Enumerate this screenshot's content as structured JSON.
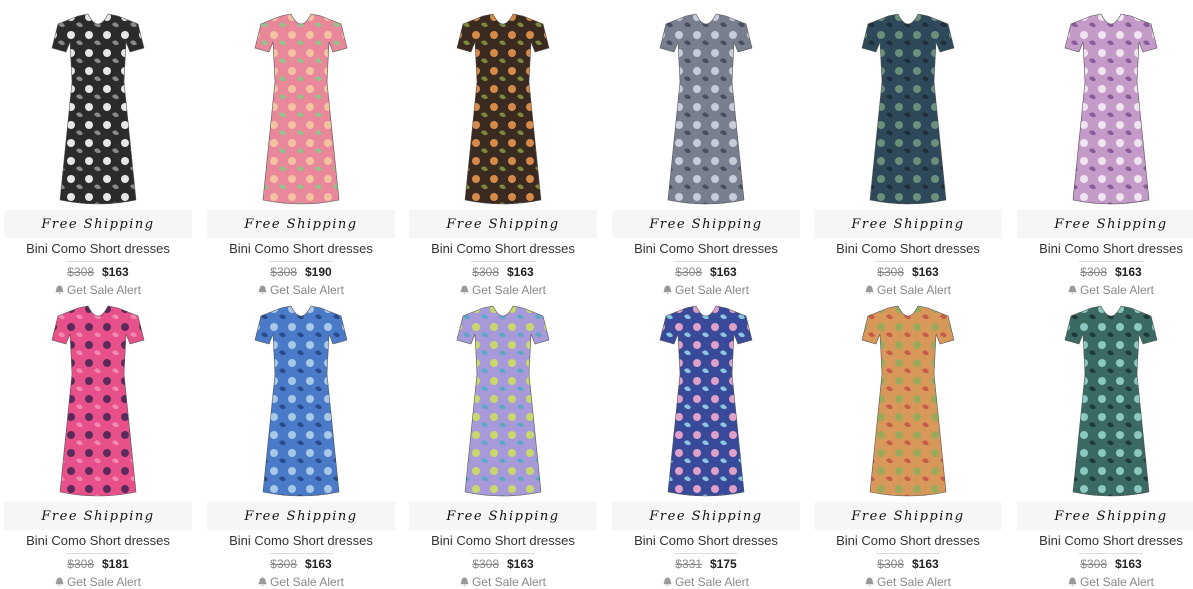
{
  "products": [
    {
      "free_shipping": "Free Shipping",
      "title": "Bini Como Short dresses",
      "old_price": "$308",
      "new_price": "$163",
      "alert": "Get Sale Alert",
      "colors": [
        "#2b2b2b",
        "#e6e6e6",
        "#8a8a8a"
      ]
    },
    {
      "free_shipping": "Free Shipping",
      "title": "Bini Como Short dresses",
      "old_price": "$308",
      "new_price": "$190",
      "alert": "Get Sale Alert",
      "colors": [
        "#e8889a",
        "#f3c3a0",
        "#8fc48a"
      ]
    },
    {
      "free_shipping": "Free Shipping",
      "title": "Bini Como Short dresses",
      "old_price": "$308",
      "new_price": "$163",
      "alert": "Get Sale Alert",
      "colors": [
        "#3a2a20",
        "#d58a4a",
        "#7a8a3a"
      ]
    },
    {
      "free_shipping": "Free Shipping",
      "title": "Bini Como Short dresses",
      "old_price": "$308",
      "new_price": "$163",
      "alert": "Get Sale Alert",
      "colors": [
        "#7a7f8f",
        "#c7ccd8",
        "#4a4f60"
      ]
    },
    {
      "free_shipping": "Free Shipping",
      "title": "Bini Como Short dresses",
      "old_price": "$308",
      "new_price": "$163",
      "alert": "Get Sale Alert",
      "colors": [
        "#2e4a5a",
        "#6a8f7a",
        "#1f2f3a"
      ]
    },
    {
      "free_shipping": "Free Shipping",
      "title": "Bini Como Short dresses",
      "old_price": "$308",
      "new_price": "$163",
      "alert": "Get Sale Alert",
      "colors": [
        "#c49ac8",
        "#f0e4f0",
        "#8a5a9a"
      ]
    },
    {
      "free_shipping": "Free Shipping",
      "title": "Bini Como Short dresses",
      "old_price": "$308",
      "new_price": "$181",
      "alert": "Get Sale Alert",
      "colors": [
        "#e8508a",
        "#5a2a5a",
        "#f08ab0"
      ]
    },
    {
      "free_shipping": "Free Shipping",
      "title": "Bini Como Short dresses",
      "old_price": "$308",
      "new_price": "$163",
      "alert": "Get Sale Alert",
      "colors": [
        "#4a7ac8",
        "#a8c8e8",
        "#2a4a8a"
      ]
    },
    {
      "free_shipping": "Free Shipping",
      "title": "Bini Como Short dresses",
      "old_price": "$308",
      "new_price": "$163",
      "alert": "Get Sale Alert",
      "colors": [
        "#a89ad8",
        "#c8d86a",
        "#5aa8c8"
      ]
    },
    {
      "free_shipping": "Free Shipping",
      "title": "Bini Como Short dresses",
      "old_price": "$331",
      "new_price": "$175",
      "alert": "Get Sale Alert",
      "colors": [
        "#3a4a9a",
        "#e0a0c8",
        "#8ac8e0"
      ]
    },
    {
      "free_shipping": "Free Shipping",
      "title": "Bini Como Short dresses",
      "old_price": "$308",
      "new_price": "$163",
      "alert": "Get Sale Alert",
      "colors": [
        "#d8985a",
        "#9aaa5a",
        "#c85a4a"
      ]
    },
    {
      "free_shipping": "Free Shipping",
      "title": "Bini Como Short dresses",
      "old_price": "$308",
      "new_price": "$163",
      "alert": "Get Sale Alert",
      "colors": [
        "#3a6a62",
        "#8ac8c0",
        "#1f3a36"
      ]
    }
  ],
  "icons": {
    "alert_icon": "bell-icon",
    "product_image": "dress-image"
  }
}
